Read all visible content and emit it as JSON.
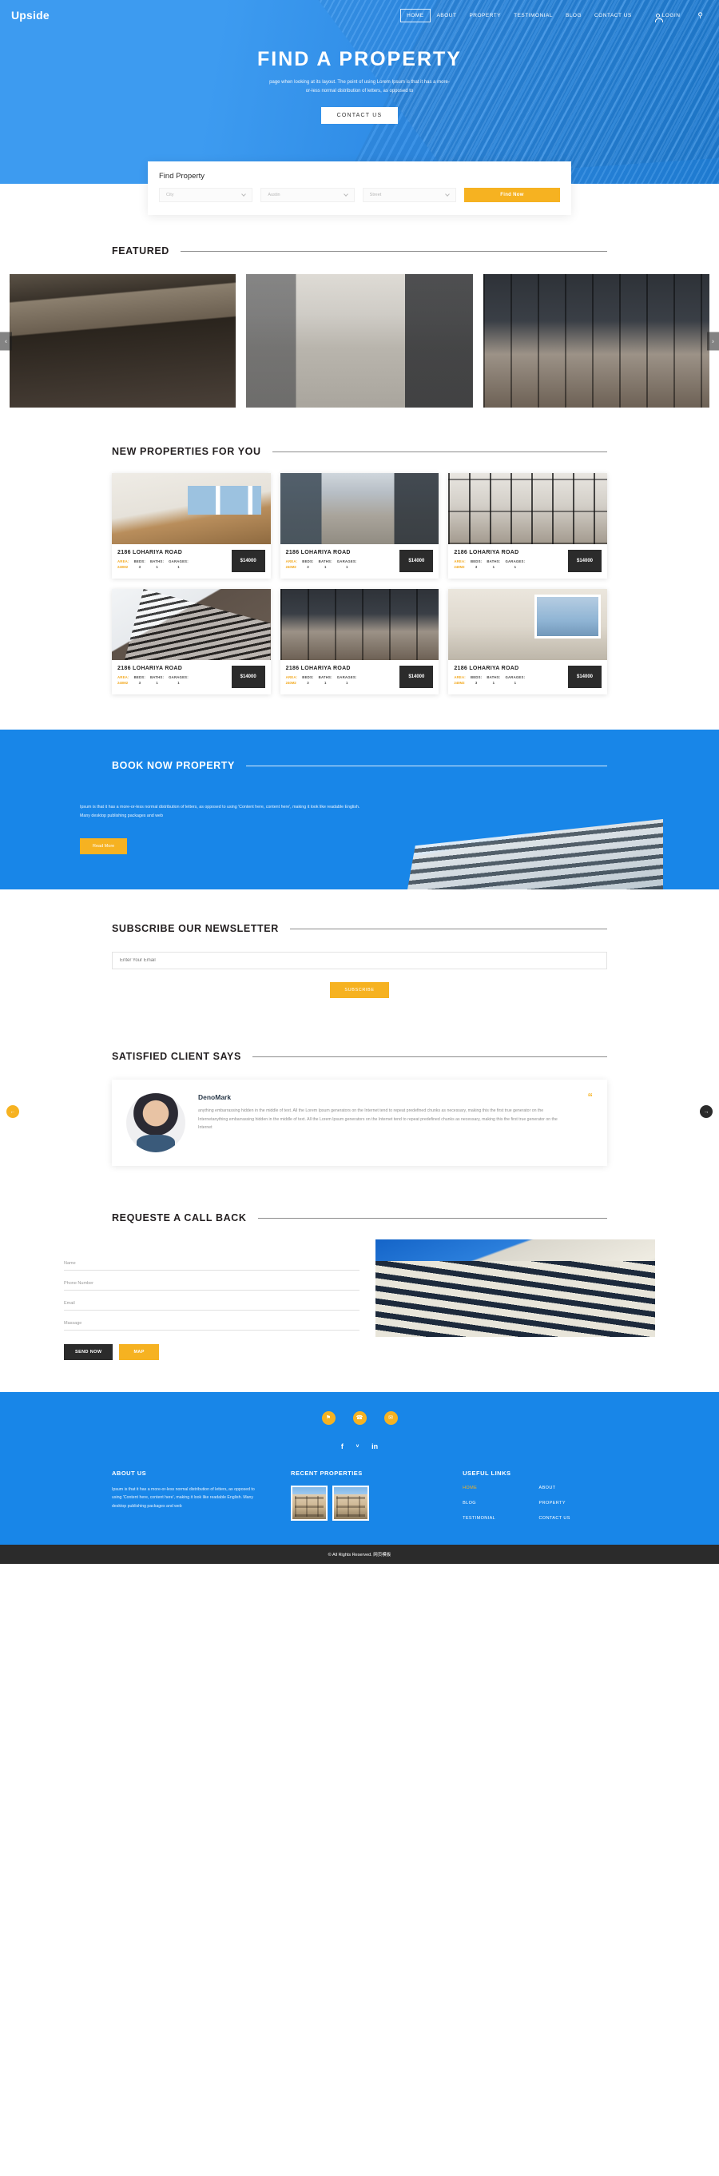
{
  "brand": {
    "name": "Upside"
  },
  "nav": {
    "items": [
      {
        "label": "HOME",
        "active": true
      },
      {
        "label": "ABOUT",
        "active": false
      },
      {
        "label": "PROPERTY",
        "active": false
      },
      {
        "label": "TESTIMONIAL",
        "active": false
      },
      {
        "label": "BLOG",
        "active": false
      },
      {
        "label": "CONTACT US",
        "active": false
      }
    ],
    "login_label": "LOGIN",
    "login_icon": "user-icon",
    "search_icon": "search-icon"
  },
  "hero": {
    "title": "FIND A PROPERTY",
    "subtitle_line1": "page when looking at its layout. The point of using Lorem Ipsum is that it has a more-",
    "subtitle_line2": "or-less normal distribution of letters, as opposed to",
    "cta_label": "CONTACT US"
  },
  "search": {
    "title": "Find Property",
    "field_city_value": "City",
    "field_area_value": "Austin",
    "field_street_value": "Street",
    "button_label": "Find Now"
  },
  "featured": {
    "heading": "FEATURED",
    "prev_icon": "chevron-left-icon",
    "next_icon": "chevron-right-icon",
    "prev_glyph": "‹",
    "next_glyph": "›",
    "slides": [
      {
        "name": "featured-slide-1",
        "style": "img-a"
      },
      {
        "name": "featured-slide-2",
        "style": "img-b"
      },
      {
        "name": "featured-slide-3",
        "style": "img-c"
      }
    ]
  },
  "new_properties": {
    "heading": "NEW PROPERTIES FOR YOU",
    "labels": {
      "area": "AREA:",
      "beds": "BEDS:",
      "baths": "BATHS:",
      "garages": "GARAGES:"
    },
    "cards": [
      {
        "title": "2186 LOHARIYA ROAD",
        "area": "240M2",
        "beds": "3",
        "baths": "1",
        "garages": "1",
        "price": "$14000",
        "style": "img-room"
      },
      {
        "title": "2186 LOHARIYA ROAD",
        "area": "240M2",
        "beds": "3",
        "baths": "1",
        "garages": "1",
        "price": "$14000",
        "style": "img-hall"
      },
      {
        "title": "2186 LOHARIYA ROAD",
        "area": "240M2",
        "beds": "3",
        "baths": "1",
        "garages": "1",
        "price": "$14000",
        "style": "img-glass"
      },
      {
        "title": "2186 LOHARIYA ROAD",
        "area": "240M2",
        "beds": "3",
        "baths": "1",
        "garages": "1",
        "price": "$14000",
        "style": "img-facade"
      },
      {
        "title": "2186 LOHARIYA ROAD",
        "area": "240M2",
        "beds": "3",
        "baths": "1",
        "garages": "1",
        "price": "$14000",
        "style": "img-c"
      },
      {
        "title": "2186 LOHARIYA ROAD",
        "area": "240M2",
        "beds": "3",
        "baths": "1",
        "garages": "1",
        "price": "$14000",
        "style": "img-lamp"
      }
    ]
  },
  "book_now": {
    "heading": "BOOK NOW PROPERTY",
    "paragraph": "Ipsum is that it has a more-or-less normal distribution of letters, as opposed to using 'Content here, content here', making it look like readable English. Many desktop publishing packages and web",
    "button_label": "Read More"
  },
  "newsletter": {
    "heading": "SUBSCRIBE OUR NEWSLETTER",
    "input_placeholder": "Enter Your Email",
    "button_label": "SUBSCRIBE"
  },
  "testimonial": {
    "heading": "SATISFIED CLIENT SAYS",
    "name": "DenoMark",
    "quote_glyph": "“",
    "text": "anything embarrassing hidden in the middle of text. All the Lorem Ipsum generators on the Internet tend to repeat predefined chunks as necessary, making this the first true generator on the Internetanything embarrassing hidden in the middle of text. All the Lorem Ipsum generators on the Internet tend to repeat predefined chunks as necessary, making this the first true generator on the Internet",
    "prev_glyph": "←",
    "next_glyph": "→"
  },
  "callback": {
    "heading": "REQUESTE A CALL BACK",
    "fields": [
      {
        "name": "name-field",
        "placeholder": "Name"
      },
      {
        "name": "phone-field",
        "placeholder": "Phone Number"
      },
      {
        "name": "email-field",
        "placeholder": "Email"
      },
      {
        "name": "message-field",
        "placeholder": "Massage"
      }
    ],
    "send_label": "SEND NOW",
    "map_label": "MAP"
  },
  "footer": {
    "contacts": [
      {
        "icon": "location-pin-icon",
        "glyph": "⚑"
      },
      {
        "icon": "phone-icon",
        "glyph": "☎"
      },
      {
        "icon": "envelope-icon",
        "glyph": "✉"
      }
    ],
    "social": [
      {
        "icon": "facebook-icon",
        "glyph": "f"
      },
      {
        "icon": "twitter-icon",
        "glyph": "ᵛ"
      },
      {
        "icon": "linkedin-icon",
        "glyph": "in"
      }
    ],
    "about": {
      "heading": "ABOUT US",
      "text": "Ipsum is that it has a more-or-less normal distribution of letters, as opposed to using 'Content here, content here', making it look like readable English. Many desktop publishing packages and web"
    },
    "recent": {
      "heading": "RECENT PROPERTIES"
    },
    "useful": {
      "heading": "USEFUL LINKS",
      "links": [
        {
          "label": "HOME",
          "hot": true
        },
        {
          "label": "ABOUT",
          "hot": false
        },
        {
          "label": "BLOG",
          "hot": false
        },
        {
          "label": "PROPERTY",
          "hot": false
        },
        {
          "label": "TESTIMONIAL",
          "hot": false
        },
        {
          "label": "CONTACT US",
          "hot": false
        }
      ]
    },
    "copyright": "© All Rights Reserved. 网页模板"
  },
  "colors": {
    "brand_blue": "#1886e8",
    "accent_yellow": "#f6b221",
    "dark": "#2b2b2b"
  }
}
